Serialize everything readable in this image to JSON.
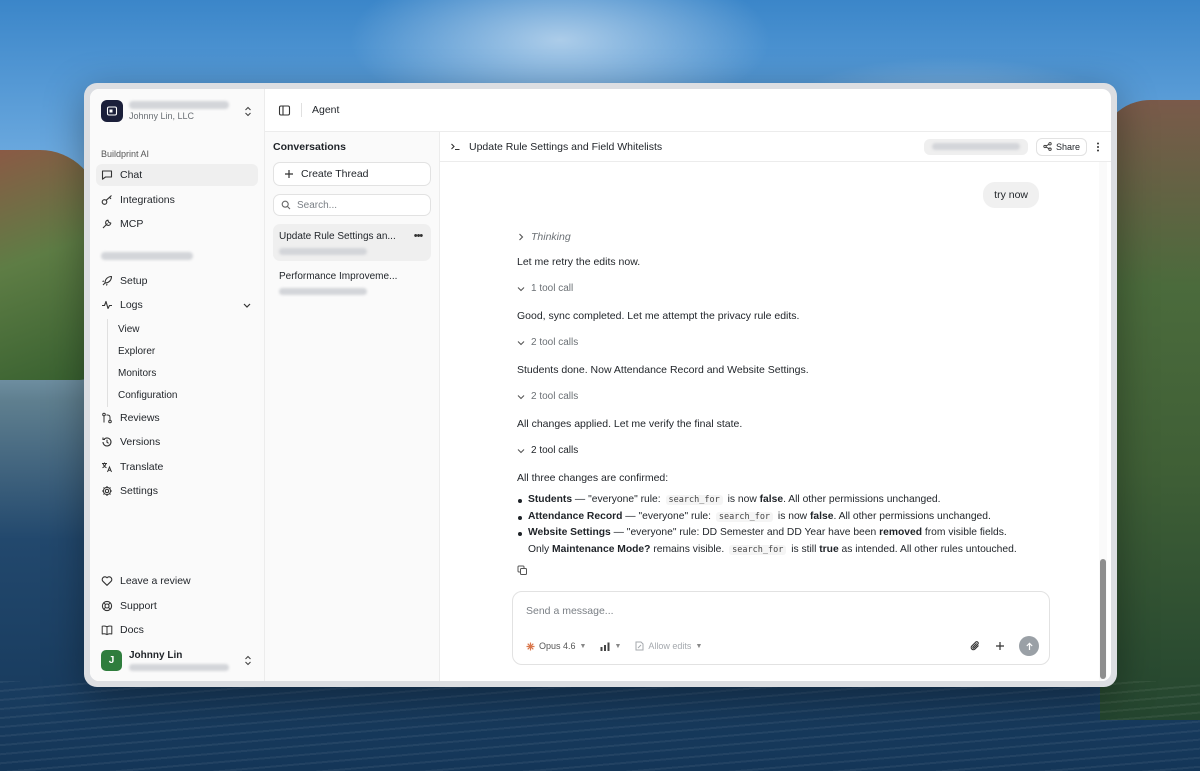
{
  "workspace": {
    "org": "Johnny Lin, LLC"
  },
  "sidebar": {
    "section_label": "Buildprint AI",
    "items": [
      {
        "label": "Chat",
        "icon": "chat-icon"
      },
      {
        "label": "Integrations",
        "icon": "key-icon"
      },
      {
        "label": "MCP",
        "icon": "wrench-icon"
      }
    ],
    "app_items": [
      {
        "label": "Setup",
        "icon": "rocket-icon"
      },
      {
        "label": "Logs",
        "icon": "activity-icon"
      }
    ],
    "logs_subitems": [
      "View",
      "Explorer",
      "Monitors",
      "Configuration"
    ],
    "more_items": [
      {
        "label": "Reviews",
        "icon": "branch-icon"
      },
      {
        "label": "Versions",
        "icon": "history-icon"
      },
      {
        "label": "Translate",
        "icon": "translate-icon"
      },
      {
        "label": "Settings",
        "icon": "gear-icon"
      }
    ],
    "bottom_items": [
      {
        "label": "Leave a review",
        "icon": "heart-icon"
      },
      {
        "label": "Support",
        "icon": "lifebuoy-icon"
      },
      {
        "label": "Docs",
        "icon": "book-icon"
      }
    ],
    "user": {
      "initial": "J",
      "name": "Johnny Lin"
    }
  },
  "topbar": {
    "title": "Agent"
  },
  "conversations": {
    "heading": "Conversations",
    "create_label": "Create Thread",
    "search_placeholder": "Search...",
    "threads": [
      {
        "title": "Update Rule Settings an..."
      },
      {
        "title": "Performance Improveme..."
      }
    ]
  },
  "chat": {
    "title": "Update Rule Settings and Field Whitelists",
    "share_label": "Share",
    "user_message": "try now",
    "thinking": "Thinking",
    "lines": [
      "Let me retry the edits now.",
      "1 tool call",
      "Good, sync completed. Let me attempt the privacy rule edits.",
      "2 tool calls",
      "Students done. Now Attendance Record and Website Settings.",
      "2 tool calls",
      "All changes applied. Let me verify the final state.",
      "2 tool calls",
      "All three changes are confirmed:"
    ],
    "bullets": {
      "b1_name": "Students",
      "b1_text1": " — \"everyone\" rule: ",
      "code": "search_for",
      "b1_text2": " is now ",
      "false_word": "false",
      "b1_text3": ". All other permissions unchanged.",
      "b2_name": "Attendance Record",
      "b2_text1": " — \"everyone\" rule: ",
      "b2_text2": " is now ",
      "b2_text3": ". All other permissions unchanged.",
      "b3_name": "Website Settings",
      "b3_text1": " — \"everyone\" rule: DD Semester and DD Year have been ",
      "removed_word": "removed",
      "b3_text2": " from visible fields. Only ",
      "maint": "Maintenance Mode?",
      "b3_text3": " remains visible. ",
      "b3_text4": " is still ",
      "true_word": "true",
      "b3_text5": " as intended. All other rules untouched."
    }
  },
  "composer": {
    "placeholder": "Send a message...",
    "model": "Opus 4.6",
    "allow_edits": "Allow edits"
  },
  "colors": {
    "accent_model": "#d9774c",
    "avatar": "#2f7d3d",
    "logo_bg": "#1b1f3a"
  }
}
